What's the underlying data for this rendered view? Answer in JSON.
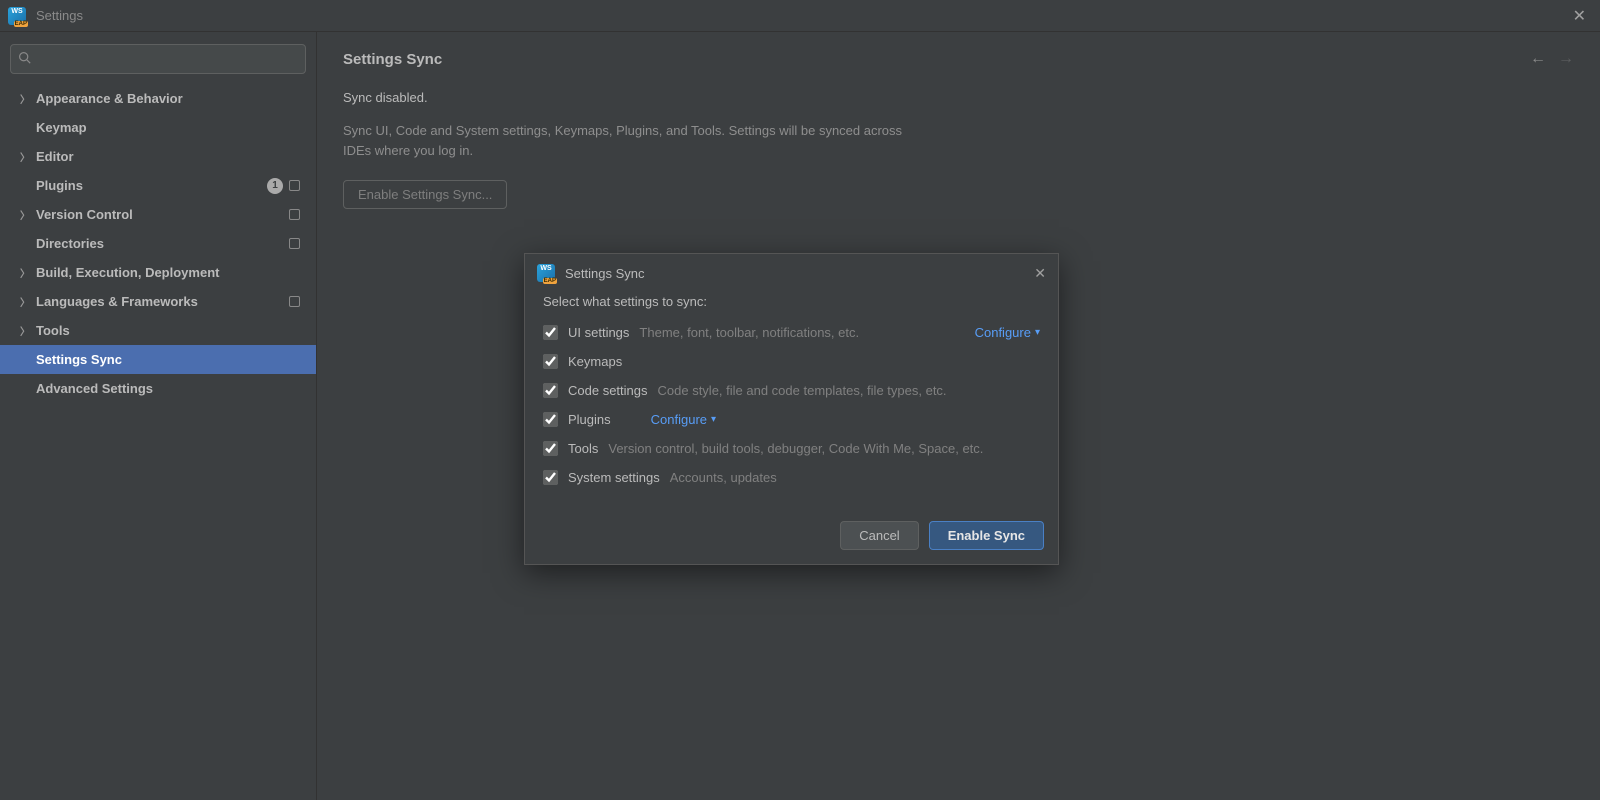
{
  "window": {
    "title": "Settings"
  },
  "search": {
    "placeholder": ""
  },
  "sidebar": {
    "items": [
      {
        "label": "Appearance & Behavior",
        "expandable": true
      },
      {
        "label": "Keymap",
        "expandable": false
      },
      {
        "label": "Editor",
        "expandable": true
      },
      {
        "label": "Plugins",
        "expandable": false,
        "badge": "1",
        "marker": true
      },
      {
        "label": "Version Control",
        "expandable": true,
        "marker": true
      },
      {
        "label": "Directories",
        "expandable": false,
        "marker": true
      },
      {
        "label": "Build, Execution, Deployment",
        "expandable": true
      },
      {
        "label": "Languages & Frameworks",
        "expandable": true,
        "marker": true
      },
      {
        "label": "Tools",
        "expandable": true
      },
      {
        "label": "Settings Sync",
        "expandable": false,
        "selected": true
      },
      {
        "label": "Advanced Settings",
        "expandable": false
      }
    ]
  },
  "content": {
    "title": "Settings Sync",
    "status": "Sync disabled.",
    "description": "Sync UI, Code and System settings, Keymaps, Plugins, and Tools. Settings will be synced across IDEs where you log in.",
    "enable_button": "Enable Settings Sync..."
  },
  "dialog": {
    "title": "Settings Sync",
    "prompt": "Select what settings to sync:",
    "options": [
      {
        "label": "UI settings",
        "desc": "Theme, font, toolbar, notifications, etc.",
        "configure": "Configure",
        "checked": true
      },
      {
        "label": "Keymaps",
        "desc": "",
        "checked": true
      },
      {
        "label": "Code settings",
        "desc": "Code style, file and code templates, file types, etc.",
        "checked": true
      },
      {
        "label": "Plugins",
        "desc": "",
        "configure": "Configure",
        "checked": true
      },
      {
        "label": "Tools",
        "desc": "Version control, build tools, debugger, Code With Me, Space, etc.",
        "checked": true
      },
      {
        "label": "System settings",
        "desc": "Accounts, updates",
        "checked": true
      }
    ],
    "cancel": "Cancel",
    "confirm": "Enable Sync"
  }
}
